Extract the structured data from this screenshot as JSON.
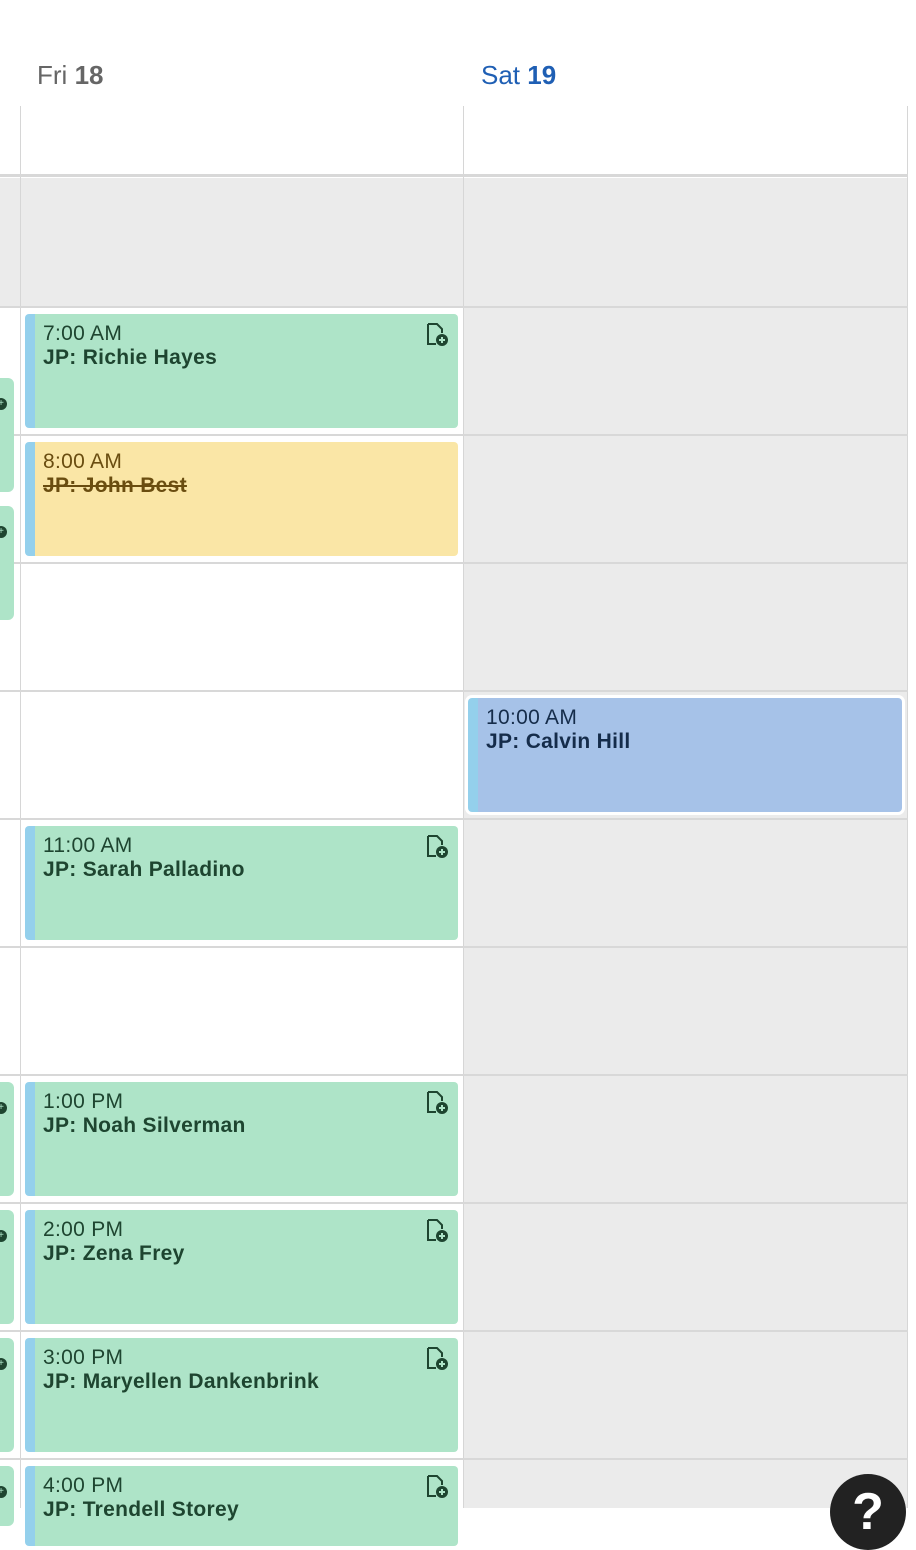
{
  "days": [
    {
      "name": "Fri",
      "num": "18"
    },
    {
      "name": "Sat",
      "num": "19"
    }
  ],
  "events": {
    "fri": [
      {
        "time": "7:00 AM",
        "title": "JP: Richie Hayes",
        "status": "confirmed"
      },
      {
        "time": "8:00 AM",
        "title": "JP: John Best",
        "status": "cancelled"
      },
      {
        "time": "11:00 AM",
        "title": "JP: Sarah Palladino",
        "status": "confirmed"
      },
      {
        "time": "1:00 PM",
        "title": "JP: Noah Silverman",
        "status": "confirmed"
      },
      {
        "time": "2:00 PM",
        "title": "JP: Zena Frey",
        "status": "confirmed"
      },
      {
        "time": "3:00 PM",
        "title": "JP: Maryellen Dankenbrink",
        "status": "confirmed"
      },
      {
        "time": "4:00 PM",
        "title": "JP: Trendell Storey",
        "status": "confirmed"
      }
    ],
    "sat": [
      {
        "time": "10:00 AM",
        "title": "JP: Calvin Hill",
        "status": "selected"
      }
    ]
  },
  "icons": {
    "event_icon": "document-add-icon",
    "help": "help-icon"
  },
  "help_label": "?",
  "colors": {
    "confirmed": "#aee4c8",
    "cancelled": "#fae6a6",
    "selected": "#a6c2e8",
    "today": "#1f5fb4",
    "unavailable": "#ebebeb",
    "accent": "#94d0ec"
  }
}
